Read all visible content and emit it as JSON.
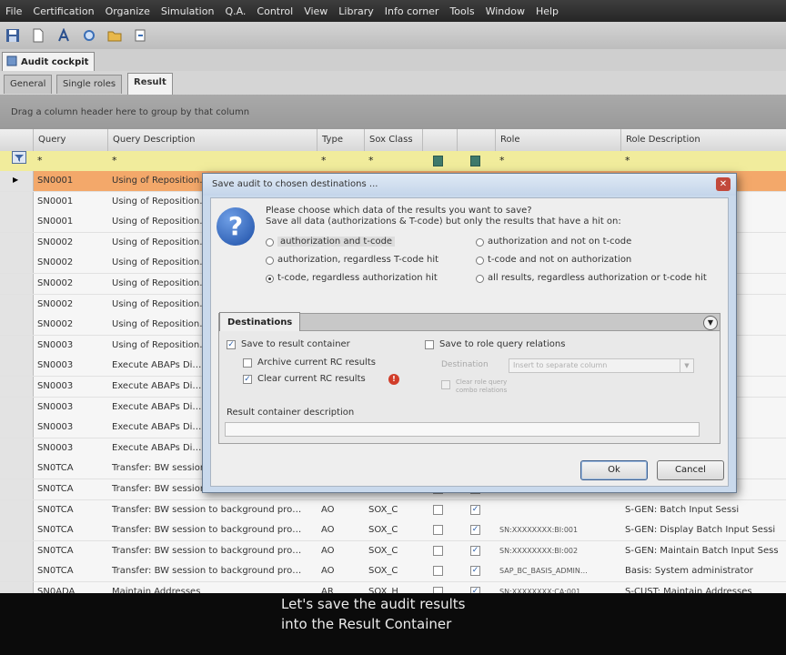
{
  "menubar": [
    "File",
    "Certification",
    "Organize",
    "Simulation",
    "Q.A.",
    "Control",
    "View",
    "Library",
    "Info corner",
    "Tools",
    "Window",
    "Help"
  ],
  "document_tab": {
    "label": "Audit cockpit"
  },
  "subtabs": [
    "General",
    "Single roles",
    "Result"
  ],
  "groupbar_text": "Drag a column header here to group by that column",
  "columns": {
    "query": "Query",
    "query_desc": "Query Description",
    "type": "Type",
    "sox": "Sox Class",
    "role": "Role",
    "role_desc": "Role Description"
  },
  "filter_symbols": {
    "star": "*"
  },
  "rows": [
    {
      "query": "SN0001",
      "desc": "Using of Reposition…",
      "type": "",
      "sox": "",
      "c1": false,
      "c2": false,
      "role": "",
      "role_desc": "Z:STUDYS: Developme",
      "selected": true
    },
    {
      "query": "SN0001",
      "desc": "Using of Reposition…",
      "type": "",
      "sox": "",
      "c1": false,
      "c2": false,
      "role": "",
      "role_desc": "s Students"
    },
    {
      "query": "SN0001",
      "desc": "Using of Reposition…",
      "type": "",
      "sox": "",
      "c1": false,
      "c2": false,
      "role": "",
      "role_desc": ""
    },
    {
      "query": "SN0002",
      "desc": "Using of Reposition…",
      "type": "",
      "sox": "",
      "c1": false,
      "c2": false,
      "role": "",
      "role_desc": "s Students"
    },
    {
      "query": "SN0002",
      "desc": "Using of Reposition…",
      "type": "",
      "sox": "",
      "c1": false,
      "c2": false,
      "role": "",
      "role_desc": "ing"
    },
    {
      "query": "SN0002",
      "desc": "Using of Reposition…",
      "type": "",
      "sox": "",
      "c1": false,
      "c2": false,
      "role": "",
      "role_desc": "Developme"
    },
    {
      "query": "SN0002",
      "desc": "Using of Reposition…",
      "type": "",
      "sox": "",
      "c1": false,
      "c2": false,
      "role": "",
      "role_desc": "eports"
    },
    {
      "query": "SN0002",
      "desc": "Using of Reposition…",
      "type": "",
      "sox": "",
      "c1": false,
      "c2": false,
      "role": "",
      "role_desc": ""
    },
    {
      "query": "SN0003",
      "desc": "Using of Reposition…",
      "type": "",
      "sox": "",
      "c1": false,
      "c2": false,
      "role": "",
      "role_desc": "s Students"
    },
    {
      "query": "SN0003",
      "desc": "Execute ABAPs Di…",
      "type": "",
      "sox": "",
      "c1": false,
      "c2": false,
      "role": "",
      "role_desc": "ing"
    },
    {
      "query": "SN0003",
      "desc": "Execute ABAPs Di…",
      "type": "",
      "sox": "",
      "c1": false,
      "c2": false,
      "role": "",
      "role_desc": "Developme"
    },
    {
      "query": "SN0003",
      "desc": "Execute ABAPs Di…",
      "type": "",
      "sox": "",
      "c1": false,
      "c2": false,
      "role": "",
      "role_desc": "eports"
    },
    {
      "query": "SN0003",
      "desc": "Execute ABAPs Di…",
      "type": "",
      "sox": "",
      "c1": false,
      "c2": false,
      "role": "",
      "role_desc": ""
    },
    {
      "query": "SN0003",
      "desc": "Execute ABAPs Di…",
      "type": "",
      "sox": "",
      "c1": false,
      "c2": false,
      "role": "",
      "role_desc": "s Students"
    },
    {
      "query": "SN0TCA",
      "desc": "Transfer: BW session…",
      "type": "",
      "sox": "",
      "c1": false,
      "c2": false,
      "role": "",
      "role_desc": "Job Admi"
    },
    {
      "query": "SN0TCA",
      "desc": "Transfer: BW session…",
      "type": "",
      "sox": "",
      "c1": false,
      "c2": false,
      "role": "",
      "role_desc": "Input Sessi"
    },
    {
      "query": "SN0TCA",
      "desc": "Transfer: BW session to background pro…",
      "type": "AO",
      "sox": "SOX_C",
      "c1": false,
      "c2": true,
      "role": "",
      "role_desc": "S-GEN: Batch Input Sessi"
    },
    {
      "query": "SN0TCA",
      "desc": "Transfer: BW session to background pro…",
      "type": "AO",
      "sox": "SOX_C",
      "c1": false,
      "c2": true,
      "role": "SN:XXXXXXXX:BI:001",
      "role_desc": "S-GEN: Display Batch Input Sessi"
    },
    {
      "query": "SN0TCA",
      "desc": "Transfer: BW session to background pro…",
      "type": "AO",
      "sox": "SOX_C",
      "c1": false,
      "c2": true,
      "role": "SN:XXXXXXXX:BI:002",
      "role_desc": "S-GEN: Maintain Batch Input Sess"
    },
    {
      "query": "SN0TCA",
      "desc": "Transfer: BW session to background pro…",
      "type": "AO",
      "sox": "SOX_C",
      "c1": false,
      "c2": true,
      "role": "SAP_BC_BASIS_ADMIN…",
      "role_desc": "Basis: System administrator"
    },
    {
      "query": "SN0ADA",
      "desc": "Maintain Addresses",
      "type": "AR",
      "sox": "SOX_H",
      "c1": false,
      "c2": true,
      "role": "SN:XXXXXXXX:CA:001",
      "role_desc": "S-CUST: Maintain Addresses"
    }
  ],
  "dialog": {
    "title": "Save audit to chosen destinations ...",
    "close": "✕",
    "question_line1": "Please choose which data of the results you want to save?",
    "question_line2": "Save all data (authorizations & T-code) but only the results that have a hit on:",
    "options": [
      {
        "label": "authorization and t-code",
        "selected": false
      },
      {
        "label": "authorization and not on t-code",
        "selected": false
      },
      {
        "label": "authorization, regardless T-code hit",
        "selected": false
      },
      {
        "label": "t-code and not on authorization",
        "selected": false
      },
      {
        "label": "t-code, regardless authorization hit",
        "selected": true
      },
      {
        "label": "all results, regardless authorization or t-code hit",
        "selected": false
      }
    ],
    "destinations_tab": "Destinations",
    "save_to_result_container": "Save to result container",
    "archive_current": "Archive current RC results",
    "clear_current": "Clear current RC results",
    "save_to_role_query": "Save to role query relations",
    "destination_label": "Destination",
    "destination_value": "Insert to separate column",
    "clear_role_query": "Clear role query combo relations",
    "result_container_desc_label": "Result container description",
    "result_container_desc_value": "",
    "ok": "Ok",
    "cancel": "Cancel"
  },
  "caption": {
    "line1": "Let's save the audit results",
    "line2": "into the Result Container"
  }
}
